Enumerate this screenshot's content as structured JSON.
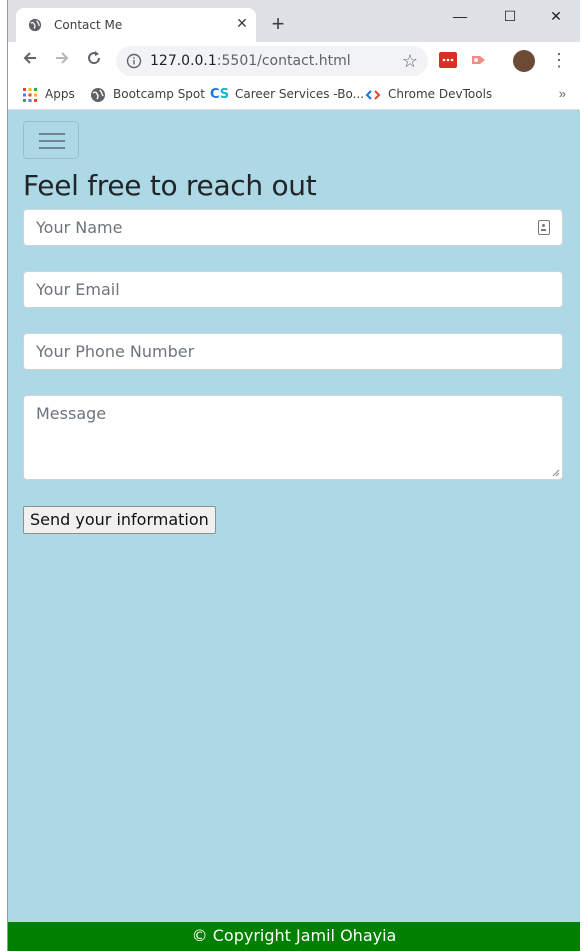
{
  "browser": {
    "tab_title": "Contact Me",
    "tab_close": "✕",
    "new_tab": "+",
    "window_buttons": {
      "minimize": "—",
      "maximize": "☐",
      "close": "✕"
    },
    "url_host": "127.0.0.1",
    "url_path": ":5501/contact.html",
    "bookmarks": [
      {
        "label": "Apps",
        "icon": "apps-grid-icon"
      },
      {
        "label": "Bootcamp Spot",
        "icon": "globe-icon"
      },
      {
        "label": "Career Services -Bo...",
        "icon": "cs-logo-icon"
      },
      {
        "label": "Chrome DevTools",
        "icon": "devtools-icon"
      }
    ],
    "bookmarks_more": "»"
  },
  "page": {
    "heading": "Feel free to reach out",
    "form": {
      "name_placeholder": "Your Name",
      "email_placeholder": "Your Email",
      "phone_placeholder": "Your Phone Number",
      "message_placeholder": "Message",
      "submit_label": "Send your information"
    },
    "footer": "© Copyright Jamil Ohayia"
  },
  "colors": {
    "page_background": "#add8e6",
    "footer_background": "#008000",
    "footer_text": "#ffffff"
  }
}
